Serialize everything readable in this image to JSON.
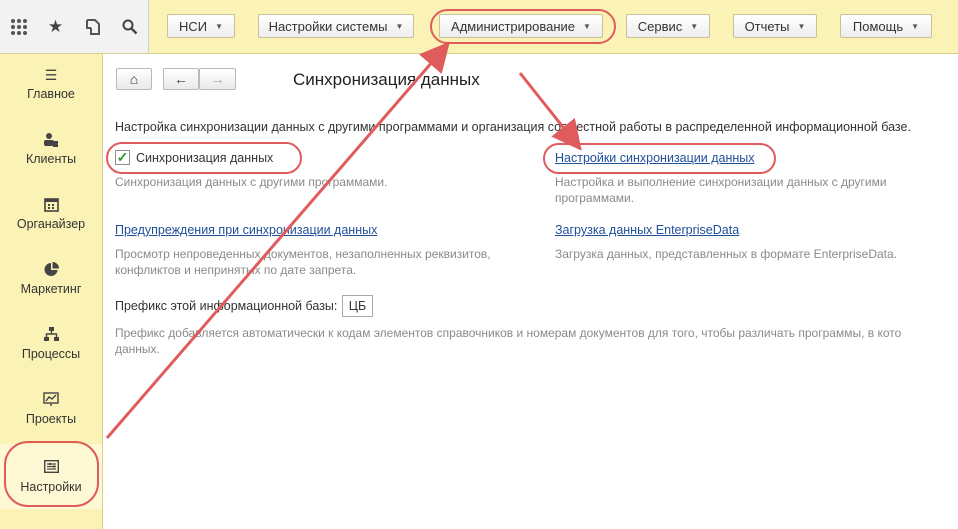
{
  "quick_icons": [
    "apps-grid-icon",
    "star-icon",
    "history-icon",
    "search-icon"
  ],
  "top_menu": [
    {
      "label": "НСИ"
    },
    {
      "label": "Настройки системы"
    },
    {
      "label": "Администрирование"
    },
    {
      "label": "Сервис"
    },
    {
      "label": "Отчеты"
    },
    {
      "label": "Помощь"
    }
  ],
  "sidebar": {
    "items": [
      {
        "label": "Главное",
        "icon": "menu-icon"
      },
      {
        "label": "Клиенты",
        "icon": "clients-icon"
      },
      {
        "label": "Органайзер",
        "icon": "calendar-icon"
      },
      {
        "label": "Маркетинг",
        "icon": "pie-chart-icon"
      },
      {
        "label": "Процессы",
        "icon": "process-icon"
      },
      {
        "label": "Проекты",
        "icon": "chart-icon"
      },
      {
        "label": "Настройки",
        "icon": "settings-icon"
      }
    ]
  },
  "nav": {
    "home": "⌂",
    "back": "←",
    "forward": "→"
  },
  "page": {
    "title": "Синхронизация данных",
    "intro": "Настройка синхронизации данных с другими программами и организация совместной работы в распределенной информационной базе.",
    "sync_checkbox": {
      "label": "Синхронизация данных",
      "checked": true,
      "desc": "Синхронизация данных с другими программами."
    },
    "sync_settings_link": {
      "label": "Настройки синхронизации данных",
      "desc_line1": "Настройка и выполнение синхронизации данных с другими",
      "desc_line2": "программами."
    },
    "warnings_link": {
      "label": "Предупреждения при синхронизации данных",
      "desc_line1": "Просмотр непроведенных документов, незаполненных реквизитов,",
      "desc_line2": "конфликтов и непринятых по дате запрета."
    },
    "enterprise_link": {
      "label": "Загрузка данных EnterpriseData",
      "desc": "Загрузка данных, представленных в формате EnterpriseData."
    },
    "prefix": {
      "label": "Префикс этой информационной базы:",
      "value": "ЦБ",
      "desc_line1": "Префикс добавляется автоматически к кодам элементов справочников и номерам документов для того, чтобы различать программы, в кото",
      "desc_line2": "данных."
    }
  },
  "accent_color": "#e05c5c"
}
